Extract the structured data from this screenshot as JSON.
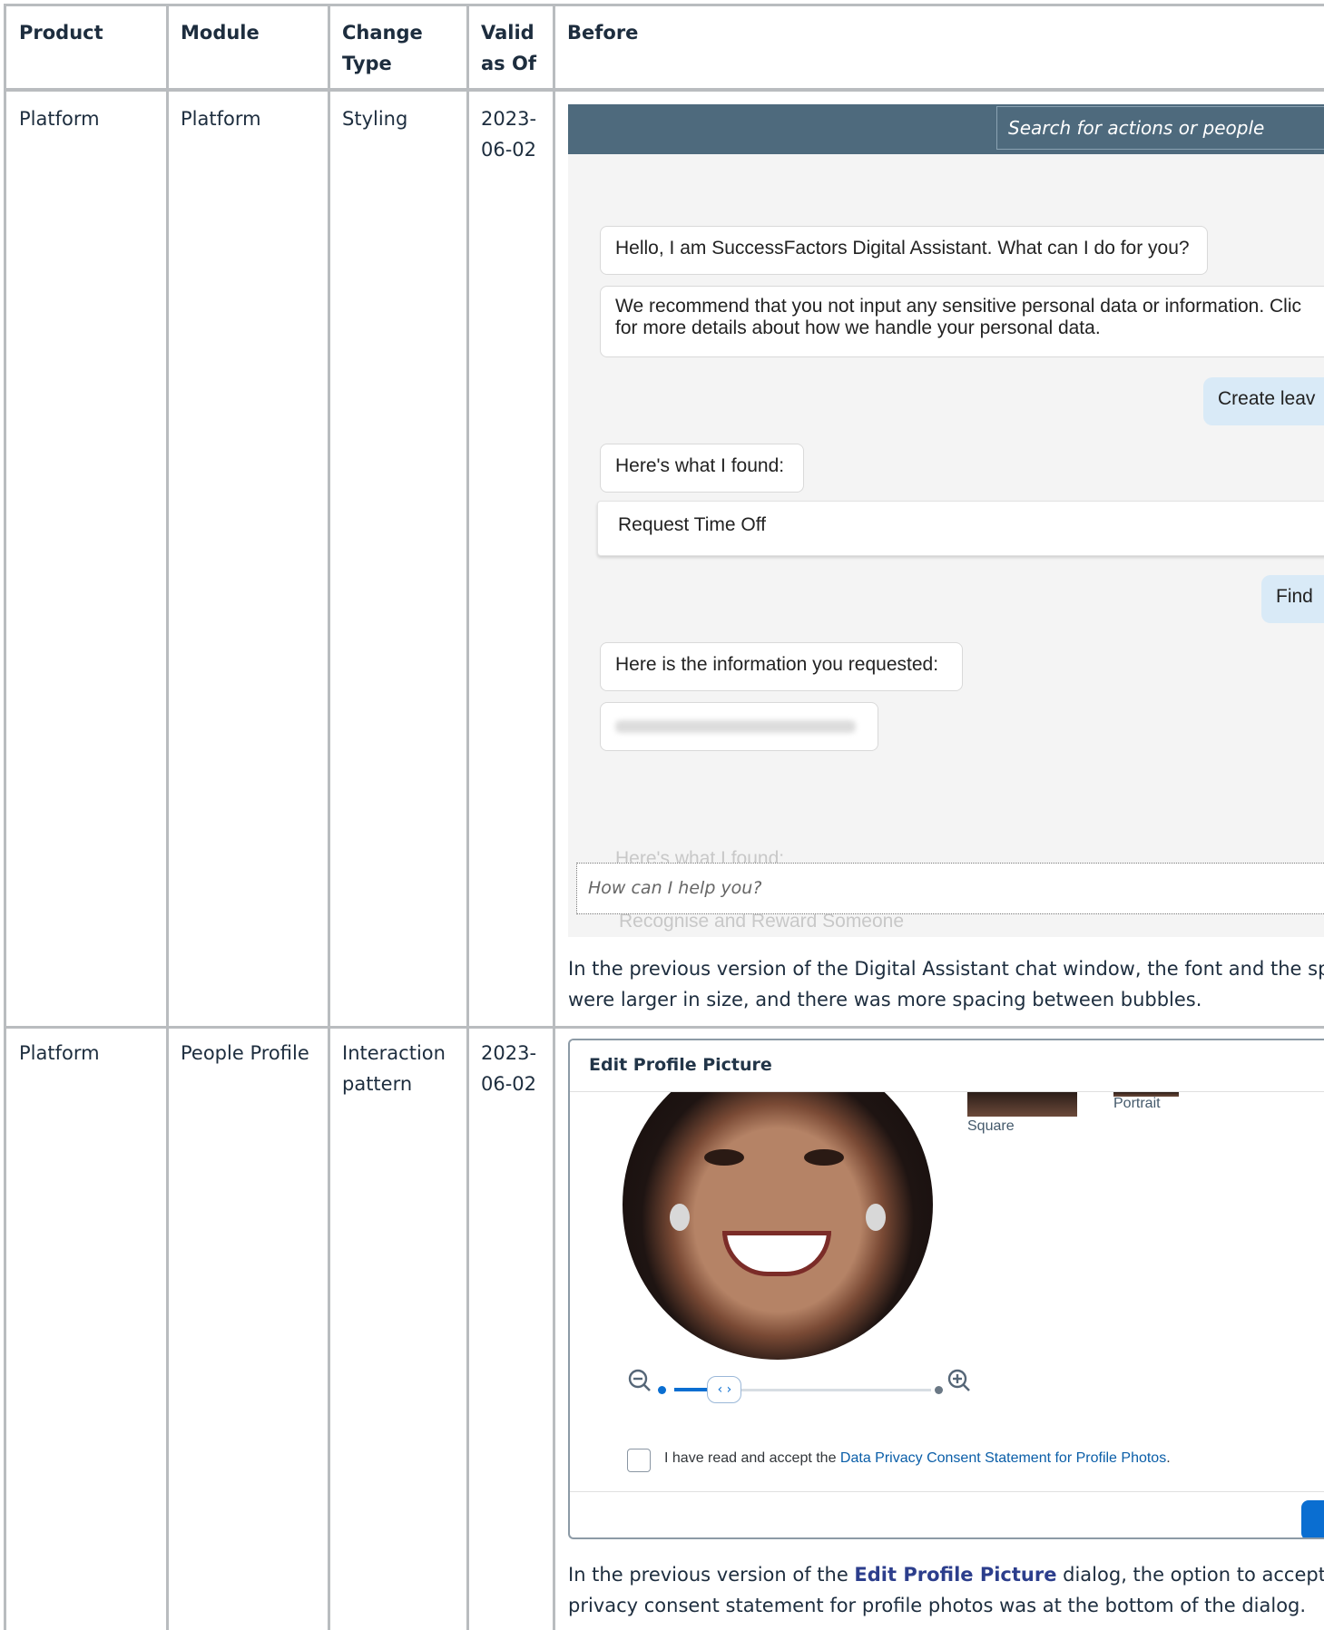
{
  "table": {
    "headers": [
      "Product",
      "Module",
      "Change",
      "Type",
      "Valid",
      "as Of",
      "Before"
    ],
    "rows": [
      {
        "product": "Platform",
        "module": "Platform",
        "change_type": [
          "Styling"
        ],
        "valid_as_of": [
          "2023-",
          "06-02"
        ],
        "description_lines": [
          "In the previous version of the Digital Assistant chat window, the font and the spee",
          "were larger in size, and there was more spacing between bubbles."
        ]
      },
      {
        "product": "Platform",
        "module": "People Profile",
        "change_type": [
          "Interaction",
          "pattern"
        ],
        "valid_as_of": [
          "2023-",
          "06-02"
        ],
        "description_prefix": "In the previous version of the ",
        "description_link": "Edit Profile Picture",
        "description_suffix": " dialog, the option to accept or c",
        "description_line2": "privacy consent statement for profile photos was at the bottom of the dialog."
      }
    ]
  },
  "chat_screenshot": {
    "search_placeholder": "Search for actions or people",
    "bubbles": [
      "Hello, I am SuccessFactors Digital Assistant. What can I do for you?",
      "We recommend that you not input any sensitive personal data or information. Clic for more details about how we handle your personal data.",
      "Here's what I found:",
      "Here is the information you requested:"
    ],
    "user_messages": [
      "Create leav",
      "Find"
    ],
    "card_label": "Request Time Off",
    "faded_bubble": "Here's what I found:",
    "faded_card": "Recognise and Reward Someone",
    "input_placeholder": "How can I help you?"
  },
  "profile_screenshot": {
    "dialog_title": "Edit Profile Picture",
    "thumb_labels": [
      "Square",
      "Portrait"
    ],
    "consent_text": "I have read and accept the ",
    "consent_link": "Data Privacy Consent Statement for Profile Photos",
    "consent_end": ".",
    "slider_level": 0.15,
    "colors": {
      "accent": "#0a6ed1",
      "header_bar": "#4e6a7d"
    }
  }
}
